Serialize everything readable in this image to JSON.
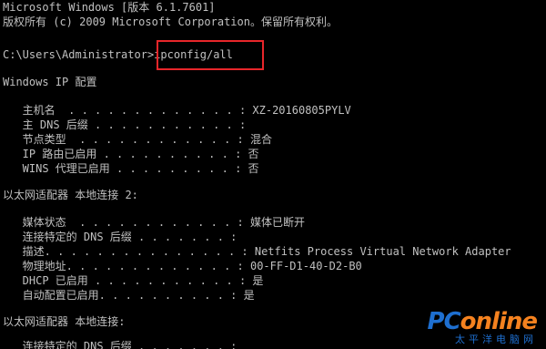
{
  "colors": {
    "background": "#000000",
    "text": "#c0c0c0",
    "highlight_border": "#e8262a",
    "watermark_blue": "#1e6fd0",
    "watermark_orange": "#f5821f"
  },
  "console": {
    "header_line_1": "Microsoft Windows [版本 6.1.7601]",
    "header_line_2": "版权所有 (c) 2009 Microsoft Corporation。保留所有权利。",
    "prompt": "C:\\Users\\Administrator>",
    "command": "ipconfig/all",
    "section_windows_ip": "Windows IP 配置",
    "host_name_line": "   主机名  . . . . . . . . . . . . . : XZ-20160805PYLV",
    "primary_dns_suffix_line": "   主 DNS 后缀 . . . . . . . . . . . :",
    "node_type_line": "   节点类型  . . . . . . . . . . . . : 混合",
    "ip_routing_line": "   IP 路由已启用 . . . . . . . . . . : 否",
    "wins_proxy_line": "   WINS 代理已启用 . . . . . . . . . : 否",
    "adapter2_header": "以太网适配器 本地连接 2:",
    "media_state_line": "   媒体状态  . . . . . . . . . . . . : 媒体已断开",
    "conn_dns_suffix_line": "   连接特定的 DNS 后缀 . . . . . . . :",
    "description_line": "   描述. . . . . . . . . . . . . . . : Netfits Process Virtual Network Adapter",
    "physical_address_line": "   物理地址. . . . . . . . . . . . . : 00-FF-D1-40-D2-B0",
    "dhcp_enabled_line": "   DHCP 已启用 . . . . . . . . . . . : 是",
    "autoconfig_enabled_line": "   自动配置已启用. . . . . . . . . . : 是",
    "adapter_header": "以太网适配器 本地连接:",
    "conn_dns_suffix_line_2": "   连接特定的 DNS 后缀 . . . . . . . :"
  },
  "watermark": {
    "logo_part_1": "PC",
    "logo_part_2": "online",
    "subtitle": "太平洋电脑网"
  }
}
